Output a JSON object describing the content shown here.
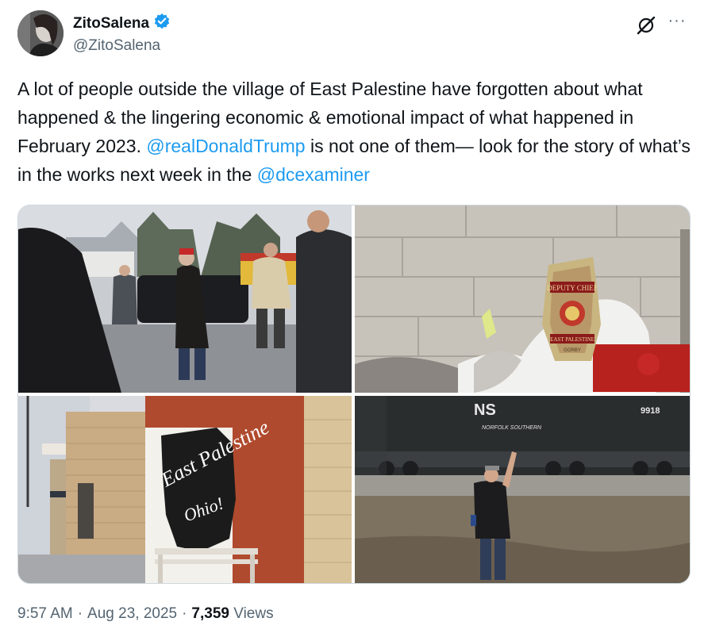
{
  "author": {
    "display_name": "ZitoSalena",
    "handle": "@ZitoSalena",
    "verified": true,
    "verified_icon": "verified-badge-icon",
    "avatar_icon": "avatar"
  },
  "actions": {
    "grok_icon": "grok-icon",
    "more_label": "···"
  },
  "tweet": {
    "text_part1": "A lot of people outside the village of East Palestine have forgotten about what happened & the lingering economic & emotional impact of what happened in February 2023. ",
    "mention1": "@realDonaldTrump",
    "text_part2": " is not one of them— look for the story of what’s in the works next week in the ",
    "mention2": "@dcexaminer"
  },
  "media": {
    "photo_count": 4,
    "helmet_shield_top": "DEPUTY CHIEF",
    "helmet_shield_bottom": "EAST PALESTINE",
    "helmet_shield_name": "GORBY",
    "mural_line1": "East Palestine",
    "mural_line2": "Ohio!",
    "locomotive_logo": "NS",
    "locomotive_name": "NORFOLK SOUTHERN",
    "locomotive_number": "9918"
  },
  "meta": {
    "time": "9:57 AM",
    "separator": "·",
    "date": "Aug 23, 2025",
    "views_count": "7,359",
    "views_label": "Views"
  },
  "colors": {
    "link": "#1d9bf0",
    "text": "#0f1419",
    "secondary": "#536471",
    "verified": "#1d9bf0"
  }
}
